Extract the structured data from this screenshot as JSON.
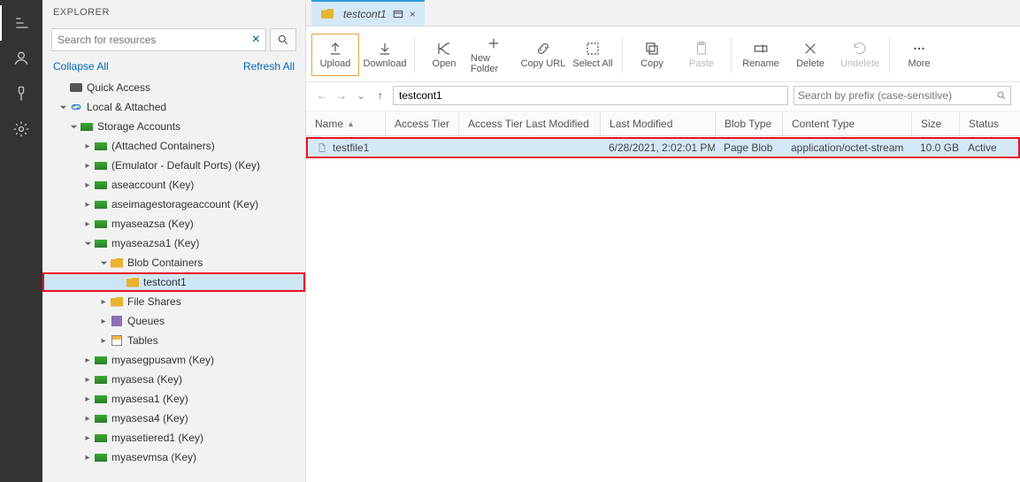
{
  "explorer": {
    "header": "EXPLORER",
    "search_placeholder": "Search for resources",
    "collapse_all": "Collapse All",
    "refresh_all": "Refresh All",
    "quick_access": "Quick Access",
    "local_attached": "Local & Attached",
    "storage_accounts": "Storage Accounts",
    "items": {
      "attached_containers": "(Attached Containers)",
      "emulator": "(Emulator - Default Ports) (Key)",
      "aseaccount": "aseaccount (Key)",
      "aseimage": "aseimagestorageaccount (Key)",
      "myaseazsa": "myaseazsa (Key)",
      "myaseazsa1": "myaseazsa1 (Key)",
      "blob_containers": "Blob Containers",
      "testcont1": "testcont1",
      "file_shares": "File Shares",
      "queues": "Queues",
      "tables": "Tables",
      "myasegpusavm": "myasegpusavm (Key)",
      "myasesa": "myasesa (Key)",
      "myasesa1": "myasesa1 (Key)",
      "myasesa4": "myasesa4 (Key)",
      "myasetiered1": "myasetiered1 (Key)",
      "myasevmsa": "myasevmsa (Key)"
    }
  },
  "tab": {
    "title": "testcont1",
    "close": "×"
  },
  "toolbar": {
    "upload": "Upload",
    "download": "Download",
    "open": "Open",
    "new_folder": "New Folder",
    "copy_url": "Copy URL",
    "select_all": "Select All",
    "copy": "Copy",
    "paste": "Paste",
    "rename": "Rename",
    "delete": "Delete",
    "undelete": "Undelete",
    "more": "More"
  },
  "nav": {
    "path": "testcont1",
    "prefix_placeholder": "Search by prefix (case-sensitive)"
  },
  "grid": {
    "headers": {
      "name": "Name",
      "access_tier": "Access Tier",
      "access_tier_last_modified": "Access Tier Last Modified",
      "last_modified": "Last Modified",
      "blob_type": "Blob Type",
      "content_type": "Content Type",
      "size": "Size",
      "status": "Status"
    },
    "row": {
      "name": "testfile1",
      "access_tier": "",
      "access_tier_last_modified": "",
      "last_modified": "6/28/2021, 2:02:01 PM",
      "blob_type": "Page Blob",
      "content_type": "application/octet-stream",
      "size": "10.0 GB",
      "status": "Active"
    }
  }
}
